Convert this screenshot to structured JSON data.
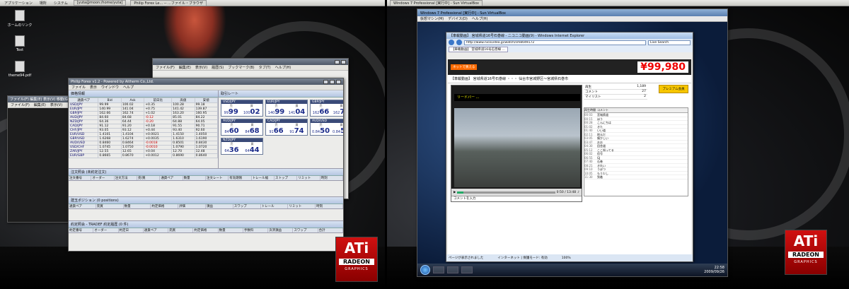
{
  "left_panel": {
    "items": [
      "アプリケーション",
      "場所",
      "システム"
    ],
    "tasks": [
      "[yuta@moon:/home/yuta]",
      "Philip Forex Le... -- ...ファイル・ブラウザ"
    ]
  },
  "desktop_icons": [
    "ホームのリンク",
    "Text",
    "theme94.pdf"
  ],
  "minor_window": {
    "title": "ファイル(F) 編集(E) 表示(V) 移動(G)",
    "menu": [
      "ファイル(F)",
      "編集(E)",
      "表示(V)"
    ]
  },
  "browser_window": {
    "menu": [
      "ファイル(F)",
      "編集(E)",
      "表示(V)",
      "履歴(S)",
      "ブックマーク(B)",
      "タブ(T)",
      "ヘルプ(H)"
    ]
  },
  "trading_window": {
    "title": "Philip Forex v1.2 - Powered by Aitherm Co.,Ltd.",
    "menu": [
      "ファイル",
      "表示",
      "ウインドウ",
      "ヘルプ"
    ],
    "price_panel_title": "価格情報",
    "price_headers": [
      "通貨ペア",
      "Bid",
      "Ask",
      "前日比",
      "高値",
      "安値"
    ],
    "price_rows": [
      [
        "USD/JPY",
        "99.99",
        "100.02",
        "+0.35",
        "100.28",
        "99.18"
      ],
      [
        "EUR/JPY",
        "140.99",
        "141.04",
        "+0.75",
        "141.42",
        "139.87"
      ],
      [
        "GBP/JPY",
        "162.66",
        "162.74",
        "+1.02",
        "163.20",
        "160.95"
      ],
      [
        "AUD/JPY",
        "84.60",
        "84.68",
        "-0.12",
        "85.01",
        "84.22"
      ],
      [
        "NZD/JPY",
        "64.36",
        "64.44",
        "-0.20",
        "64.88",
        "64.05"
      ],
      [
        "CAD/JPY",
        "91.12",
        "91.20",
        "+0.18",
        "91.55",
        "90.71"
      ],
      [
        "CHF/JPY",
        "93.05",
        "93.12",
        "+0.44",
        "93.40",
        "92.60"
      ],
      [
        "EUR/USD",
        "1.4101",
        "1.4104",
        "+0.0021",
        "1.4150",
        "1.4050"
      ],
      [
        "GBP/USD",
        "1.6268",
        "1.6274",
        "+0.0035",
        "1.6310",
        "1.6190"
      ],
      [
        "AUD/USD",
        "0.8460",
        "0.8464",
        "-0.0018",
        "0.8501",
        "0.8430"
      ],
      [
        "USD/CHF",
        "1.0745",
        "1.0750",
        "-0.0010",
        "1.0790",
        "1.0720"
      ],
      [
        "ZAR/JPY",
        "12.55",
        "12.65",
        "+0.04",
        "12.70",
        "12.48"
      ],
      [
        "EUR/GBP",
        "0.8665",
        "0.8670",
        "+0.0012",
        "0.8690",
        "0.8640"
      ]
    ],
    "rate_panel_title": "取引レート",
    "rates": [
      {
        "pair": "USD/JPY",
        "bid_int": "99",
        "bid": "99",
        "ask_int": "100",
        "ask": "02"
      },
      {
        "pair": "EUR/JPY",
        "bid_int": "140",
        "bid": "99",
        "ask_int": "141",
        "ask": "04"
      },
      {
        "pair": "GBP/JPY",
        "bid_int": "162",
        "bid": "66",
        "ask_int": "162",
        "ask": "76"
      },
      {
        "pair": "AUD/JPY",
        "bid_int": "84",
        "bid": "60",
        "ask_int": "84",
        "ask": "68"
      },
      {
        "pair": "CAD/JPY",
        "bid_int": "91",
        "bid": "66",
        "ask_int": "91",
        "ask": "74"
      },
      {
        "pair": "AUD/USD",
        "bid_int": "0.84",
        "bid": "50",
        "ask_int": "0.84",
        "ask": "58"
      },
      {
        "pair": "NZD/JPY",
        "bid_int": "64",
        "bid": "36",
        "ask_int": "64",
        "ask": "44"
      }
    ],
    "orders_title": "注文照会 (未約定注文)",
    "orders_headers": [
      "注文番号",
      "オーダー",
      "注文方法",
      "売/買",
      "通貨ペア",
      "数量",
      "注文レート",
      "有効期限",
      "トレール幅",
      "ストップ",
      "リミット",
      "時刻"
    ],
    "positions_title": "建玉ポジション (0 positions)",
    "positions_headers": [
      "通貨ペア",
      "売買",
      "数量",
      "約定価格",
      "評価",
      "損益",
      "スワップ",
      "トレール",
      "リミット",
      "時刻"
    ],
    "history_title": "約定照会 - TRADEF 約定履歴 (0 件)",
    "history_headers": [
      "約定番号",
      "オーダー",
      "約定日",
      "通貨ペア",
      "売買",
      "約定価格",
      "数量",
      "手数料",
      "決済損益",
      "スワップ",
      "合計"
    ]
  },
  "ati_badge": {
    "brand": "ATi",
    "product": "RADEON",
    "sub": "GRAPHICS"
  },
  "vm_window": {
    "title": "Windows 7 Professional [実行中] - Sun VirtualBox",
    "menu": [
      "仮想マシン(M)",
      "デバイス(D)",
      "ヘルプ(H)"
    ],
    "clock_time": "22:58",
    "clock_date": "2009/09/26"
  },
  "ie_window": {
    "title": "【車載動画】 宮城県道16号石巻線 ‐ ニコニコ動画(9) - Windows Internet Explorer",
    "address": "http://www.nicovideo.jp/watch/sm8049172",
    "search_placeholder": "Live Search",
    "tab": "【車載動画】 宮城県道16号石巻線 ...",
    "banner_ad": "ネットで買える",
    "banner_price": "¥99,980",
    "video_title": "【車載動画】 宮城県道16号石巻線 ・・・ 仙台市宮城野区〜宮城県石巻市",
    "ticker": "リードバー ...",
    "player_time": "0:50 / 13:48",
    "comment_placeholder": "コメントを入力",
    "stats": [
      {
        "label": "再生",
        "value": "1,189"
      },
      {
        "label": "コメント",
        "value": "27"
      },
      {
        "label": "マイリスト",
        "value": "2"
      }
    ],
    "premium_button": "プレミアム会員",
    "comment_list_header": [
      "再生時間",
      "コメント"
    ],
    "comments": [
      {
        "t": "00:03",
        "c": "宮城県道"
      },
      {
        "t": "00:15",
        "c": "ほう"
      },
      {
        "t": "00:28",
        "c": "こんにちは"
      },
      {
        "t": "01:02",
        "c": "きた"
      },
      {
        "t": "01:40",
        "c": "いい道"
      },
      {
        "t": "02:11",
        "c": "地元だ"
      },
      {
        "t": "03:05",
        "c": "懐かしい"
      },
      {
        "t": "03:47",
        "c": "おお"
      },
      {
        "t": "04:30",
        "c": "田舎道"
      },
      {
        "t": "05:12",
        "c": "ここ知ってる"
      },
      {
        "t": "06:02",
        "c": "信号"
      },
      {
        "t": "06:55",
        "c": "GJ"
      },
      {
        "t": "07:40",
        "c": "石巻"
      },
      {
        "t": "08:21",
        "c": "きれい"
      },
      {
        "t": "09:10",
        "c": "うぽつ"
      },
      {
        "t": "10:05",
        "c": "もう少し"
      },
      {
        "t": "11:30",
        "c": "到着"
      }
    ],
    "status_text": "ページが表示されました",
    "status_zone": "インターネット | 保護モード: 有効",
    "zoom": "100%"
  }
}
